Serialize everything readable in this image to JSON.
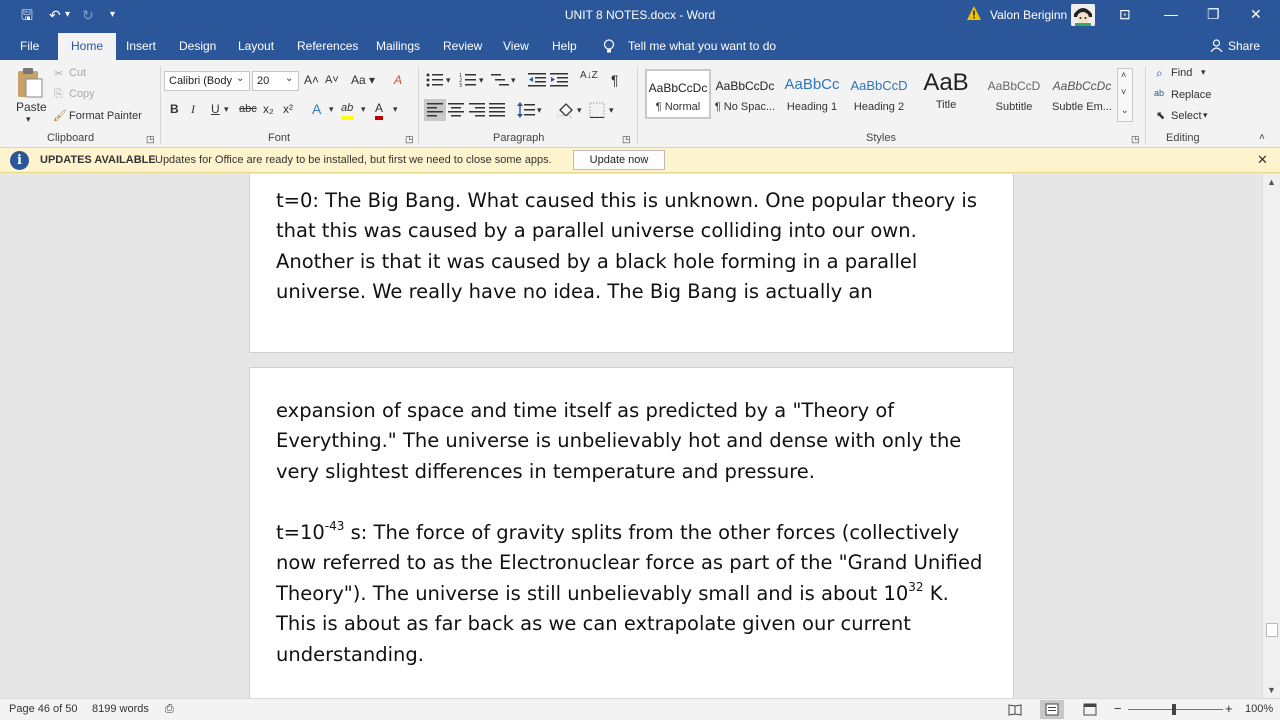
{
  "titlebar": {
    "title": "UNIT 8 NOTES.docx - Word",
    "user_name": "Valon Beriginn",
    "save_glyph": "🖫",
    "undo_glyph": "↶",
    "redo_glyph": "↻",
    "customize_glyph": "▾",
    "ribbon_display_glyph": "⊡",
    "minimize_glyph": "—",
    "restore_glyph": "❐",
    "close_glyph": "✕"
  },
  "tabs": {
    "file": "File",
    "home": "Home",
    "insert": "Insert",
    "design": "Design",
    "layout": "Layout",
    "references": "References",
    "mailings": "Mailings",
    "review": "Review",
    "view": "View",
    "help": "Help",
    "tell_me": "Tell me what you want to do",
    "share": "Share"
  },
  "clipboard": {
    "paste": "Paste",
    "cut": "Cut",
    "copy": "Copy",
    "format_painter": "Format Painter",
    "label": "Clipboard"
  },
  "font": {
    "name": "Calibri (Body",
    "size": "20",
    "grow": "A˄",
    "shrink": "A˅",
    "change_case": "Aa ▾",
    "clear_format": "A",
    "bold": "B",
    "italic": "I",
    "underline": "U",
    "strikethrough": "abc",
    "subscript": "x₂",
    "superscript": "x²",
    "text_effects": "A",
    "highlight": "ab",
    "font_color": "A",
    "label": "Font"
  },
  "paragraph": {
    "label": "Paragraph",
    "show_marks": "¶",
    "sort": "A↓Z"
  },
  "styles": {
    "label": "Styles",
    "items": [
      {
        "preview": "AaBbCcDc",
        "name": "¶ Normal"
      },
      {
        "preview": "AaBbCcDc",
        "name": "¶ No Spac..."
      },
      {
        "preview": "AaBbCc",
        "name": "Heading 1"
      },
      {
        "preview": "AaBbCcD",
        "name": "Heading 2"
      },
      {
        "preview": "AaB",
        "name": "Title"
      },
      {
        "preview": "AaBbCcD",
        "name": "Subtitle"
      },
      {
        "preview": "AaBbCcDc",
        "name": "Subtle Em..."
      }
    ]
  },
  "editing": {
    "find": "Find",
    "replace": "Replace",
    "select": "Select",
    "label": "Editing"
  },
  "update_bar": {
    "title": "UPDATES AVAILABLE",
    "message": "Updates for Office are ready to be installed, but first we need to close some apps.",
    "button": "Update now",
    "close": "✕"
  },
  "document": {
    "p1": "t=0: The Big Bang. What caused this is unknown. One popular theory is that this was caused by a parallel universe colliding into our own. Another is that it was caused by a black hole forming in a parallel universe. We really have no idea. The Big Bang is actually an",
    "p2": "expansion of space and time itself as predicted by a \"Theory of Everything.\" The universe is unbelievably hot and dense with only the very slightest differences in temperature and pressure.",
    "p3_a": "t=10",
    "p3_sup1": "-43",
    "p3_b": " s: The force of gravity splits from the other forces (collectively now referred to as the Electronuclear force as part of the \"Grand Unified Theory\"). The universe is still unbelievably small and is about 10",
    "p3_sup2": "32",
    "p3_c": " K. This is about as far back as we can extrapolate given our current understanding."
  },
  "status": {
    "page": "Page 46 of 50",
    "words": "8199 words",
    "zoom": "100%",
    "zoom_level": 0.46
  },
  "colors": {
    "brand": "#2b579a",
    "update_bar": "#fff4ce",
    "highlight": "#ffff00",
    "font_color": "#c00000"
  }
}
